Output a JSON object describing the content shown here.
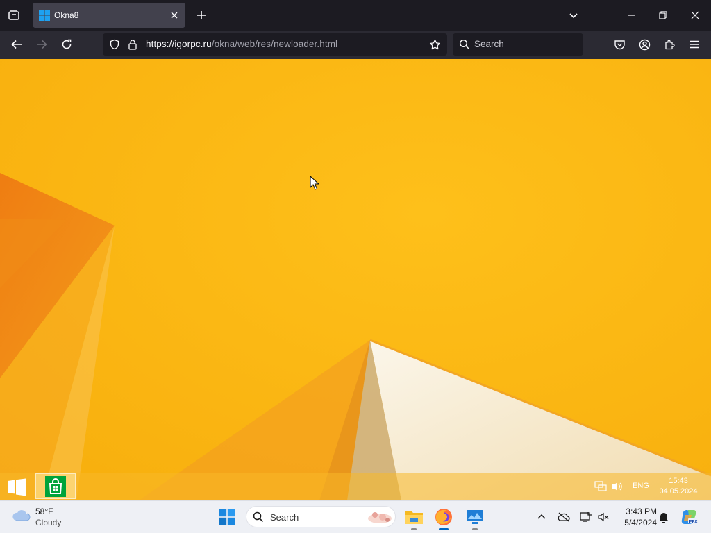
{
  "browser": {
    "tab": {
      "title": "Okna8"
    },
    "url": {
      "host": "https://igorpc.ru",
      "path": "/okna/web/res/newloader.html"
    },
    "search": {
      "placeholder": "Search"
    }
  },
  "win8": {
    "tray": {
      "language": "ENG",
      "time": "15:43",
      "date": "04.05.2024"
    }
  },
  "taskbar": {
    "weather": {
      "temp": "58°F",
      "condition": "Cloudy"
    },
    "search": {
      "placeholder": "Search"
    },
    "clock": {
      "time": "3:43 PM",
      "date": "5/4/2024"
    },
    "apps": [
      "file-explorer",
      "firefox",
      "remote-desktop"
    ]
  },
  "colors": {
    "wallpaper": "#f6b50d",
    "store_green": "#00a33b",
    "browser_dark": "#1c1b22",
    "toolbar": "#2b2a33",
    "win11_accent": "#0067c0"
  }
}
